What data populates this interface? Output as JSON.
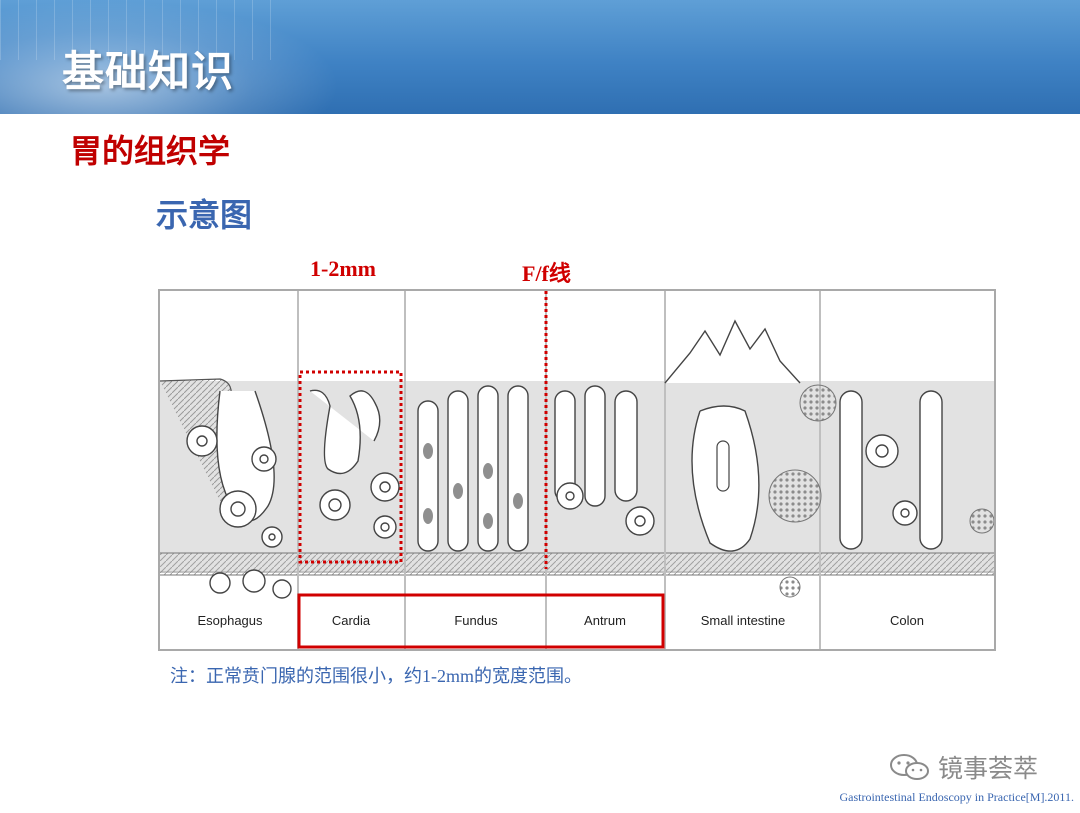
{
  "header": {
    "title": "基础知识"
  },
  "section": {
    "title": "胃的组织学"
  },
  "subsection": {
    "title": "示意图"
  },
  "diagram": {
    "annotations": {
      "width_label": "1-2mm",
      "line_label": "F/f线"
    },
    "regions": [
      "Esophagus",
      "Cardia",
      "Fundus",
      "Antrum",
      "Small intestine",
      "Colon"
    ],
    "highlight_color": "#d00000"
  },
  "caption": "注：正常贲门腺的范围很小，约1-2mm的宽度范围。",
  "watermark": {
    "text": "镜事荟萃",
    "icon": "wechat-icon"
  },
  "reference": "Gastrointestinal Endoscopy in Practice[M].2011.",
  "colors": {
    "header_blue": "#3f82c4",
    "section_red": "#c00000",
    "subtitle_blue": "#3a66b0"
  }
}
